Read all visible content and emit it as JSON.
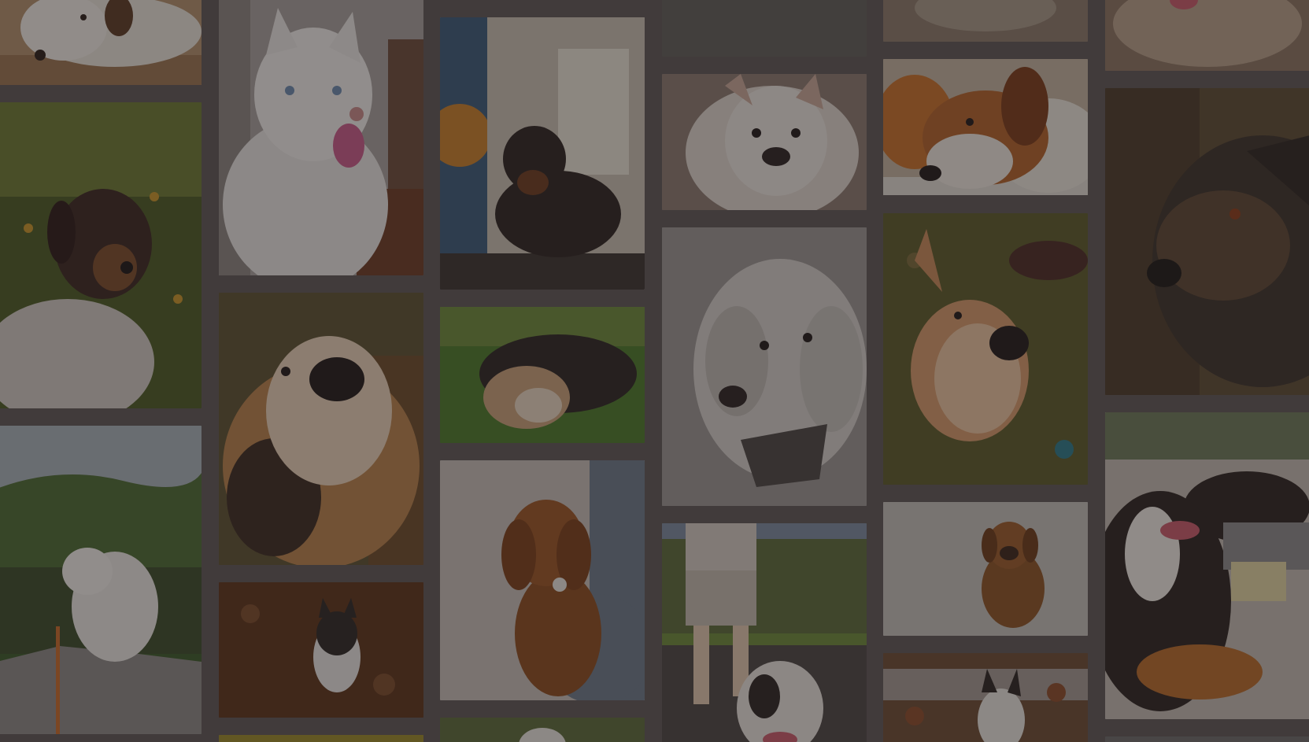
{
  "background_color": "#4a4444",
  "overlay_color": "rgba(40,34,34,0.35)",
  "columns": [
    {
      "name": "column-1",
      "tiles": [
        {
          "name": "puppy-lying-photo",
          "icon": "dog-photo",
          "bg": "#c9a27a",
          "subject": "#e9e3da"
        },
        {
          "name": "tricolor-dog-grass-photo",
          "icon": "dog-photo",
          "bg": "#5e6a2c",
          "subject": "#3c2a22"
        },
        {
          "name": "white-dog-mountain-photo",
          "icon": "dog-photo",
          "bg": "#4d6a3a",
          "subject": "#e7e6e2"
        }
      ]
    },
    {
      "name": "column-2",
      "tiles": [
        {
          "name": "white-husky-photo",
          "icon": "dog-photo",
          "bg": "#b9b3ad",
          "subject": "#f1efec"
        },
        {
          "name": "corgi-closeup-photo",
          "icon": "dog-photo",
          "bg": "#6b5a3e",
          "subject": "#c58a4a"
        },
        {
          "name": "border-collie-leaves-photo",
          "icon": "dog-photo",
          "bg": "#6a3a22",
          "subject": "#2a2624"
        },
        {
          "name": "yellow-strip-photo",
          "icon": "photo",
          "bg": "#9a8a2a",
          "subject": "#9a8a2a"
        }
      ]
    },
    {
      "name": "column-3",
      "tiles": [
        {
          "name": "black-dog-porch-photo",
          "icon": "dog-photo",
          "bg": "#8a7f72",
          "subject": "#2a2220"
        },
        {
          "name": "sleeping-dog-grass-photo",
          "icon": "dog-photo",
          "bg": "#4f7a2e",
          "subject": "#7a5a3a"
        },
        {
          "name": "spaniel-puppy-held-photo",
          "icon": "dog-photo",
          "bg": "#c9c3bd",
          "subject": "#9a5024"
        },
        {
          "name": "green-strip-photo",
          "icon": "photo",
          "bg": "#5a6a3a",
          "subject": "#e9e6e0"
        }
      ]
    },
    {
      "name": "column-4",
      "tiles": [
        {
          "name": "asphalt-photo",
          "icon": "photo",
          "bg": "#6a6866",
          "subject": "#6a6866"
        },
        {
          "name": "french-bulldog-photo",
          "icon": "dog-photo",
          "bg": "#9e8c82",
          "subject": "#e7e1dc"
        },
        {
          "name": "grey-terrier-photo",
          "icon": "dog-photo",
          "bg": "#a4a09e",
          "subject": "#d9d6d2"
        },
        {
          "name": "bulldog-walk-photo",
          "icon": "dog-photo",
          "bg": "#6a7a4a",
          "subject": "#e9e4df"
        }
      ]
    },
    {
      "name": "column-5",
      "tiles": [
        {
          "name": "dog-fur-photo",
          "icon": "photo",
          "bg": "#9a8a7a",
          "subject": "#9a8a7a"
        },
        {
          "name": "beagle-lying-photo",
          "icon": "dog-photo",
          "bg": "#c9b8a4",
          "subject": "#b26a2a"
        },
        {
          "name": "corgi-petting-photo",
          "icon": "dog-photo",
          "bg": "#6a6a3a",
          "subject": "#d69a6a"
        },
        {
          "name": "brown-puppy-carpet-photo",
          "icon": "dog-photo",
          "bg": "#c9c6c2",
          "subject": "#8a5224"
        },
        {
          "name": "dog-leaves-puddle-photo",
          "icon": "dog-photo",
          "bg": "#7a5a44",
          "subject": "#e9e6e0"
        }
      ]
    },
    {
      "name": "column-6",
      "tiles": [
        {
          "name": "fluffy-dog-photo",
          "icon": "photo",
          "bg": "#9a8472",
          "subject": "#b8a08a"
        },
        {
          "name": "scruffy-dog-profile-photo",
          "icon": "dog-photo",
          "bg": "#6a5a42",
          "subject": "#3a3028"
        },
        {
          "name": "bernese-laptop-photo",
          "icon": "dog-photo",
          "bg": "#c9c3bb",
          "subject": "#2a2220"
        },
        {
          "name": "bottom-strip-photo",
          "icon": "photo",
          "bg": "#6a6a6a",
          "subject": "#6a6a6a"
        }
      ]
    }
  ]
}
